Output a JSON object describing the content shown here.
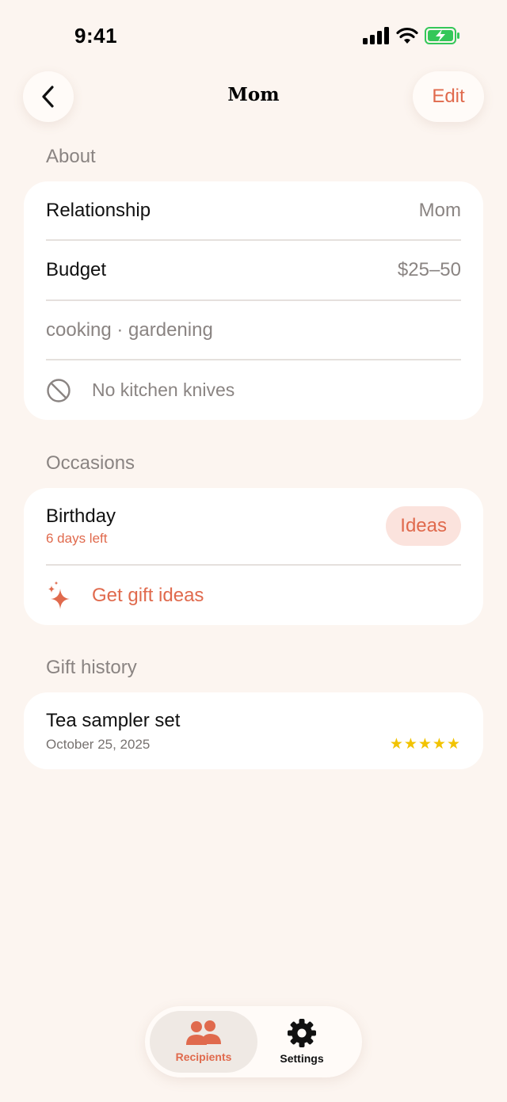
{
  "status_bar": {
    "time": "9:41"
  },
  "header": {
    "title": "Mom",
    "edit_label": "Edit"
  },
  "about": {
    "heading": "About",
    "relationship_label": "Relationship",
    "relationship_value": "Mom",
    "budget_label": "Budget",
    "budget_value": "$25–50",
    "interests": "cooking · gardening",
    "restriction": "No kitchen knives"
  },
  "occasions": {
    "heading": "Occasions",
    "name": "Birthday",
    "countdown": "6 days left",
    "ideas_label": "Ideas",
    "get_ideas_label": "Get gift ideas"
  },
  "gift_history": {
    "heading": "Gift history",
    "items": [
      {
        "name": "Tea sampler set",
        "date": "October 25, 2025",
        "stars": "★★★★★",
        "rating": 5
      }
    ]
  },
  "tabs": [
    {
      "label": "Recipients",
      "active": true
    },
    {
      "label": "Settings",
      "active": false
    }
  ],
  "colors": {
    "background": "#fcf5f0",
    "accent": "#e06a4d",
    "accent_soft": "#fbe3dd",
    "star": "#f2c300"
  }
}
